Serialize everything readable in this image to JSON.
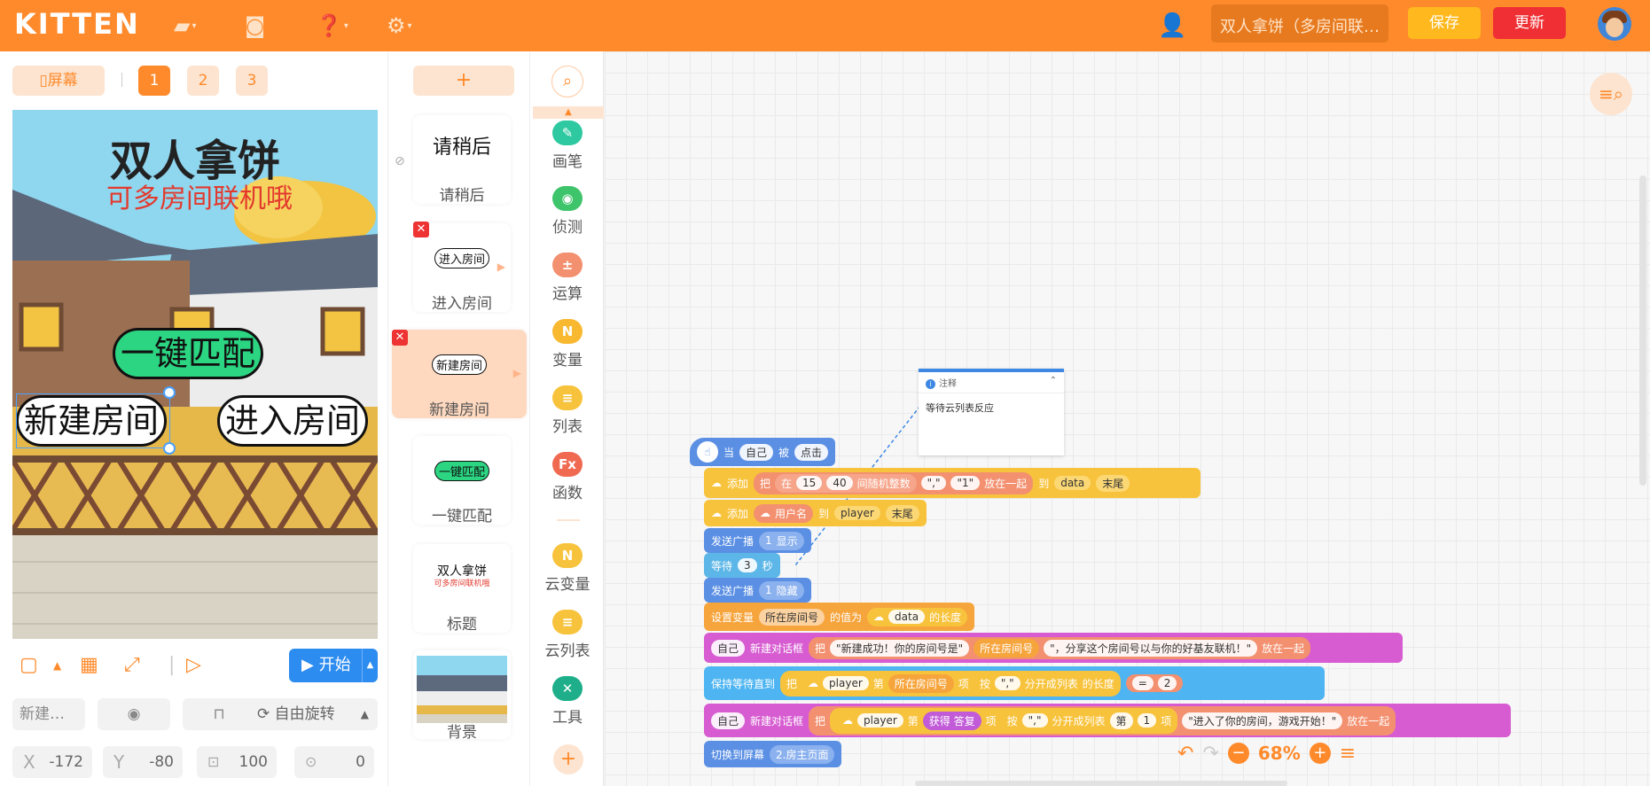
{
  "header": {
    "logo": "KITTEN",
    "project_title": "双人拿饼（多房间联…",
    "save_label": "保存",
    "update_label": "更新"
  },
  "left": {
    "screen_label": "屏幕",
    "pages": [
      "1",
      "2",
      "3"
    ],
    "stage": {
      "title": "双人拿饼",
      "subtitle": "可多房间联机哦",
      "btn_match": "一键匹配",
      "btn_new": "新建房间",
      "btn_enter": "进入房间"
    },
    "start_label": "开始",
    "prop_name": "新建…",
    "rotate_label": "自由旋转",
    "x_label": "X",
    "x_value": "-172",
    "y_label": "Y",
    "y_value": "-80",
    "size_value": "100",
    "angle_value": "0"
  },
  "sprites": [
    {
      "thumb": "请稍后",
      "name": "请稍后"
    },
    {
      "thumb": "进入房间",
      "name": "进入房间"
    },
    {
      "thumb": "新建房间",
      "name": "新建房间"
    },
    {
      "thumb": "一键匹配",
      "name": "一键匹配"
    },
    {
      "thumb_title": "双人拿饼",
      "thumb_sub": "可多房间联机哦",
      "name": "标题"
    },
    {
      "name": "背景"
    }
  ],
  "add_sprite": "+",
  "categories": [
    {
      "name": "画笔",
      "color": "#2ec9a0",
      "icon": "pen-icon"
    },
    {
      "name": "侦测",
      "color": "#3ec46a",
      "icon": "detect-icon"
    },
    {
      "name": "运算",
      "color": "#f3906f",
      "icon": "calc-icon"
    },
    {
      "name": "变量",
      "color": "#f8b82f",
      "icon": "variable-icon"
    },
    {
      "name": "列表",
      "color": "#f8c33c",
      "icon": "list-icon"
    },
    {
      "name": "函数",
      "color": "#f06a52",
      "icon": "function-icon"
    },
    {
      "name": "云变量",
      "color": "#f8c33c",
      "icon": "cloud-var-icon"
    },
    {
      "name": "云列表",
      "color": "#f8c33c",
      "icon": "cloud-list-icon"
    },
    {
      "name": "工具",
      "color": "#1eaf8a",
      "icon": "tool-icon"
    }
  ],
  "comment": {
    "header": "注释",
    "text": "等待云列表反应"
  },
  "blocks": {
    "when": "当",
    "self": "自己",
    "by": "被",
    "click": "点击",
    "add": "添加",
    "put": "把",
    "at": "在",
    "n15": "15",
    "n40": "40",
    "rand": "间随机整数",
    "comma": "\",\"",
    "one": "\"1\"",
    "join": "放在一起",
    "to": "到",
    "data": "data",
    "end": "末尾",
    "username": "用户名",
    "player": "player",
    "broadcast": "发送广播",
    "show": "显示",
    "wait": "等待",
    "three": "3",
    "sec": "秒",
    "hide": "隐藏",
    "setvar": "设置变量",
    "roomno": "所在房间号",
    "value_is": "的值为",
    "length": "的长度",
    "dialog": "新建对话框",
    "created": "\"新建成功！你的房间号是\"",
    "share": "\"，分享这个房间号以与你的好基友联机！\"",
    "keepwait": "保持等待直到",
    "nth": "第",
    "item": "项",
    "by_sep": "按",
    "split": "分开成列表",
    "eq": "=",
    "two": "2",
    "get_answer": "获得 答复",
    "joined": "\"进入了你的房间，游戏开始！\"",
    "switch": "切换到屏幕",
    "main": "2.房主页面"
  },
  "zoom": "68%"
}
